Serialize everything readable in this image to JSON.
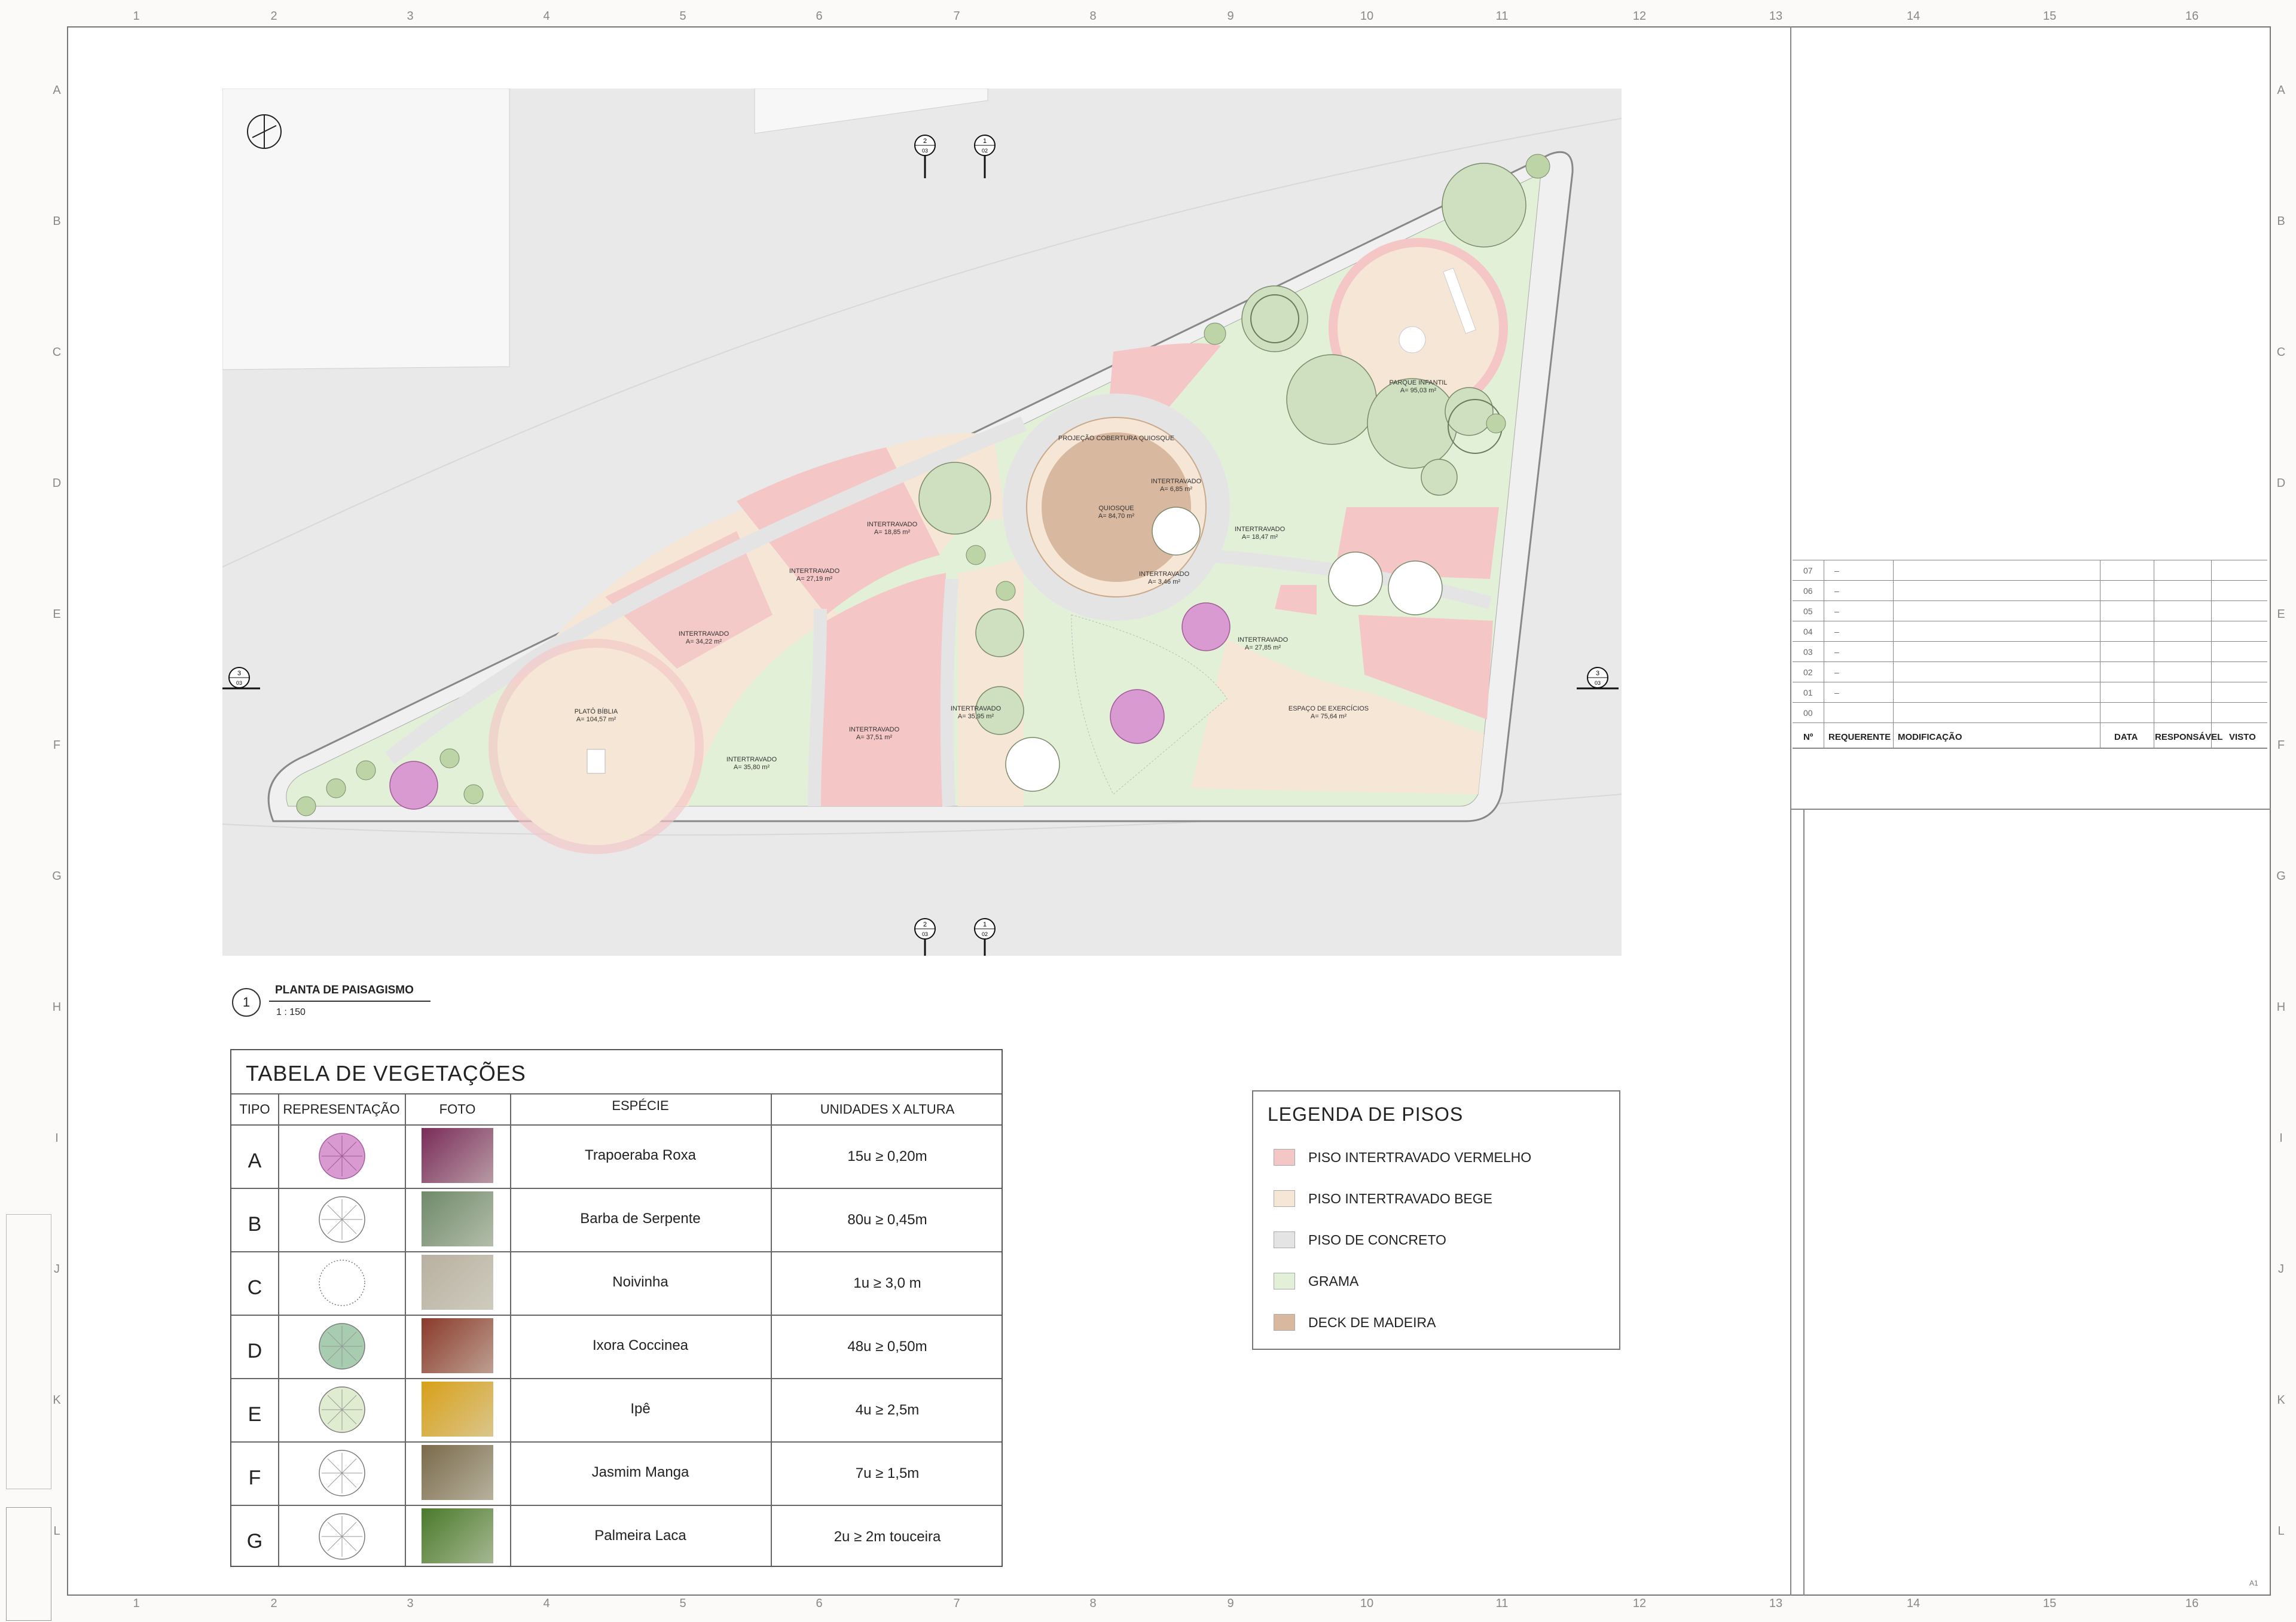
{
  "grid": {
    "columns": [
      "1",
      "2",
      "3",
      "4",
      "5",
      "6",
      "7",
      "8",
      "9",
      "10",
      "11",
      "12",
      "13",
      "14",
      "15",
      "16"
    ],
    "rows": [
      "A",
      "B",
      "C",
      "D",
      "E",
      "F",
      "G",
      "H",
      "I",
      "J",
      "K",
      "L"
    ]
  },
  "plan": {
    "labels": [
      {
        "name": "Parque Infantil",
        "title": "PARQUE INFANTIL",
        "area": "A= 95,03 m²"
      },
      {
        "name": "Quiosque",
        "title": "QUIOSQUE",
        "area": "A= 84,70 m²"
      },
      {
        "name": "Projecao",
        "title": "PROJEÇÃO COBERTURA QUIOSQUE",
        "area": ""
      },
      {
        "name": "Interdavado 6",
        "title": "INTERTRAVADO",
        "area": "A= 6,85 m²"
      },
      {
        "name": "Interdavado 18",
        "title": "INTERTRAVADO",
        "area": "A= 18,47 m²"
      },
      {
        "name": "Interdavado 3",
        "title": "INTERTRAVADO",
        "area": "A= 3,46 m²"
      },
      {
        "name": "Interdavado 27",
        "title": "INTERTRAVADO",
        "area": "A= 27,85 m²"
      },
      {
        "name": "Interdavado 1885",
        "title": "INTERTRAVADO",
        "area": "A= 18,85 m²"
      },
      {
        "name": "Interdavado 2719",
        "title": "INTERTRAVADO",
        "area": "A= 27,19 m²"
      },
      {
        "name": "Interdavado 3422",
        "title": "INTERTRAVADO",
        "area": "A= 34,22 m²"
      },
      {
        "name": "Plato",
        "title": "PLATÔ BÍBLIA",
        "area": "A= 104,57 m²"
      },
      {
        "name": "Interdavado 3580",
        "title": "INTERTRAVADO",
        "area": "A= 35,80 m²"
      },
      {
        "name": "Interdavado 3751",
        "title": "INTERTRAVADO",
        "area": "A= 37,51 m²"
      },
      {
        "name": "Interdavado 3595",
        "title": "INTERTRAVADO",
        "area": "A= 35,95 m²"
      },
      {
        "name": "Exercicios",
        "title": "ESPAÇO DE EXERCÍCIOS",
        "area": "A= 75,64 m²"
      }
    ],
    "section_marks": [
      {
        "num": "2",
        "sheet": "03"
      },
      {
        "num": "1",
        "sheet": "02"
      },
      {
        "num": "3",
        "sheet": "03"
      },
      {
        "num": "3",
        "sheet": "03"
      },
      {
        "num": "2",
        "sheet": "03"
      },
      {
        "num": "1",
        "sheet": "02"
      }
    ]
  },
  "caption": {
    "number": "1",
    "title": "PLANTA DE PAISAGISMO",
    "scale": "1 : 150"
  },
  "vegetation_table": {
    "title": "TABELA DE VEGETAÇÕES",
    "headers": [
      "TIPO",
      "REPRESENTAÇÃO",
      "FOTO",
      "ESPÉCIE",
      "UNIDADES X ALTURA"
    ],
    "rows": [
      {
        "tipo": "A",
        "especie": "Trapoeraba Roxa",
        "unidades": "15u ≥ 0,20m",
        "symbol": "purple-flower",
        "photo_color": "#7a2c5a"
      },
      {
        "tipo": "B",
        "especie": "Barba de Serpente",
        "unidades": "80u  ≥ 0,45m",
        "symbol": "grass-circle",
        "photo_color": "#6f8a6a"
      },
      {
        "tipo": "C",
        "especie": "Noivinha",
        "unidades": "1u ≥ 3,0 m",
        "symbol": "dotted-circle",
        "photo_color": "#b8b0a0"
      },
      {
        "tipo": "D",
        "especie": "Ixora Coccinea",
        "unidades": "48u ≥ 0,50m",
        "symbol": "pink-green-circle",
        "photo_color": "#8a3a2a"
      },
      {
        "tipo": "E",
        "especie": "Ipê",
        "unidades": "4u ≥ 2,5m",
        "symbol": "yellow-green-circle",
        "photo_color": "#d8a018"
      },
      {
        "tipo": "F",
        "especie": "Jasmim Manga",
        "unidades": "7u ≥ 1,5m",
        "symbol": "tree-circle",
        "photo_color": "#7a6a4a"
      },
      {
        "tipo": "G",
        "especie": "Palmeira Laca",
        "unidades": "2u ≥ 2m touceira",
        "symbol": "palm",
        "photo_color": "#4a7a2a"
      }
    ]
  },
  "legend": {
    "title": "LEGENDA DE PISOS",
    "items": [
      {
        "label": "PISO INTERTRAVADO VERMELHO",
        "color": "#f4c6c6"
      },
      {
        "label": "PISO INTERTRAVADO BEGE",
        "color": "#f6e6d6"
      },
      {
        "label": "PISO DE CONCRETO",
        "color": "#e4e4e4"
      },
      {
        "label": "GRAMA",
        "color": "#e2f0d8"
      },
      {
        "label": "DECK DE MADEIRA",
        "color": "#d9b8a0"
      }
    ]
  },
  "revisions": {
    "rows": [
      {
        "num": "07",
        "mod": "–"
      },
      {
        "num": "06",
        "mod": "–"
      },
      {
        "num": "05",
        "mod": "–"
      },
      {
        "num": "04",
        "mod": "–"
      },
      {
        "num": "03",
        "mod": "–"
      },
      {
        "num": "02",
        "mod": "–"
      },
      {
        "num": "01",
        "mod": "–"
      },
      {
        "num": "00",
        "mod": ""
      }
    ],
    "headers": {
      "n": "Nº",
      "req": "REQUERENTE",
      "mod": "MODIFICAÇÃO",
      "data": "DATA",
      "resp": "RESPONSÁVEL",
      "visto": "VISTO"
    }
  },
  "sheet_size": "A1"
}
